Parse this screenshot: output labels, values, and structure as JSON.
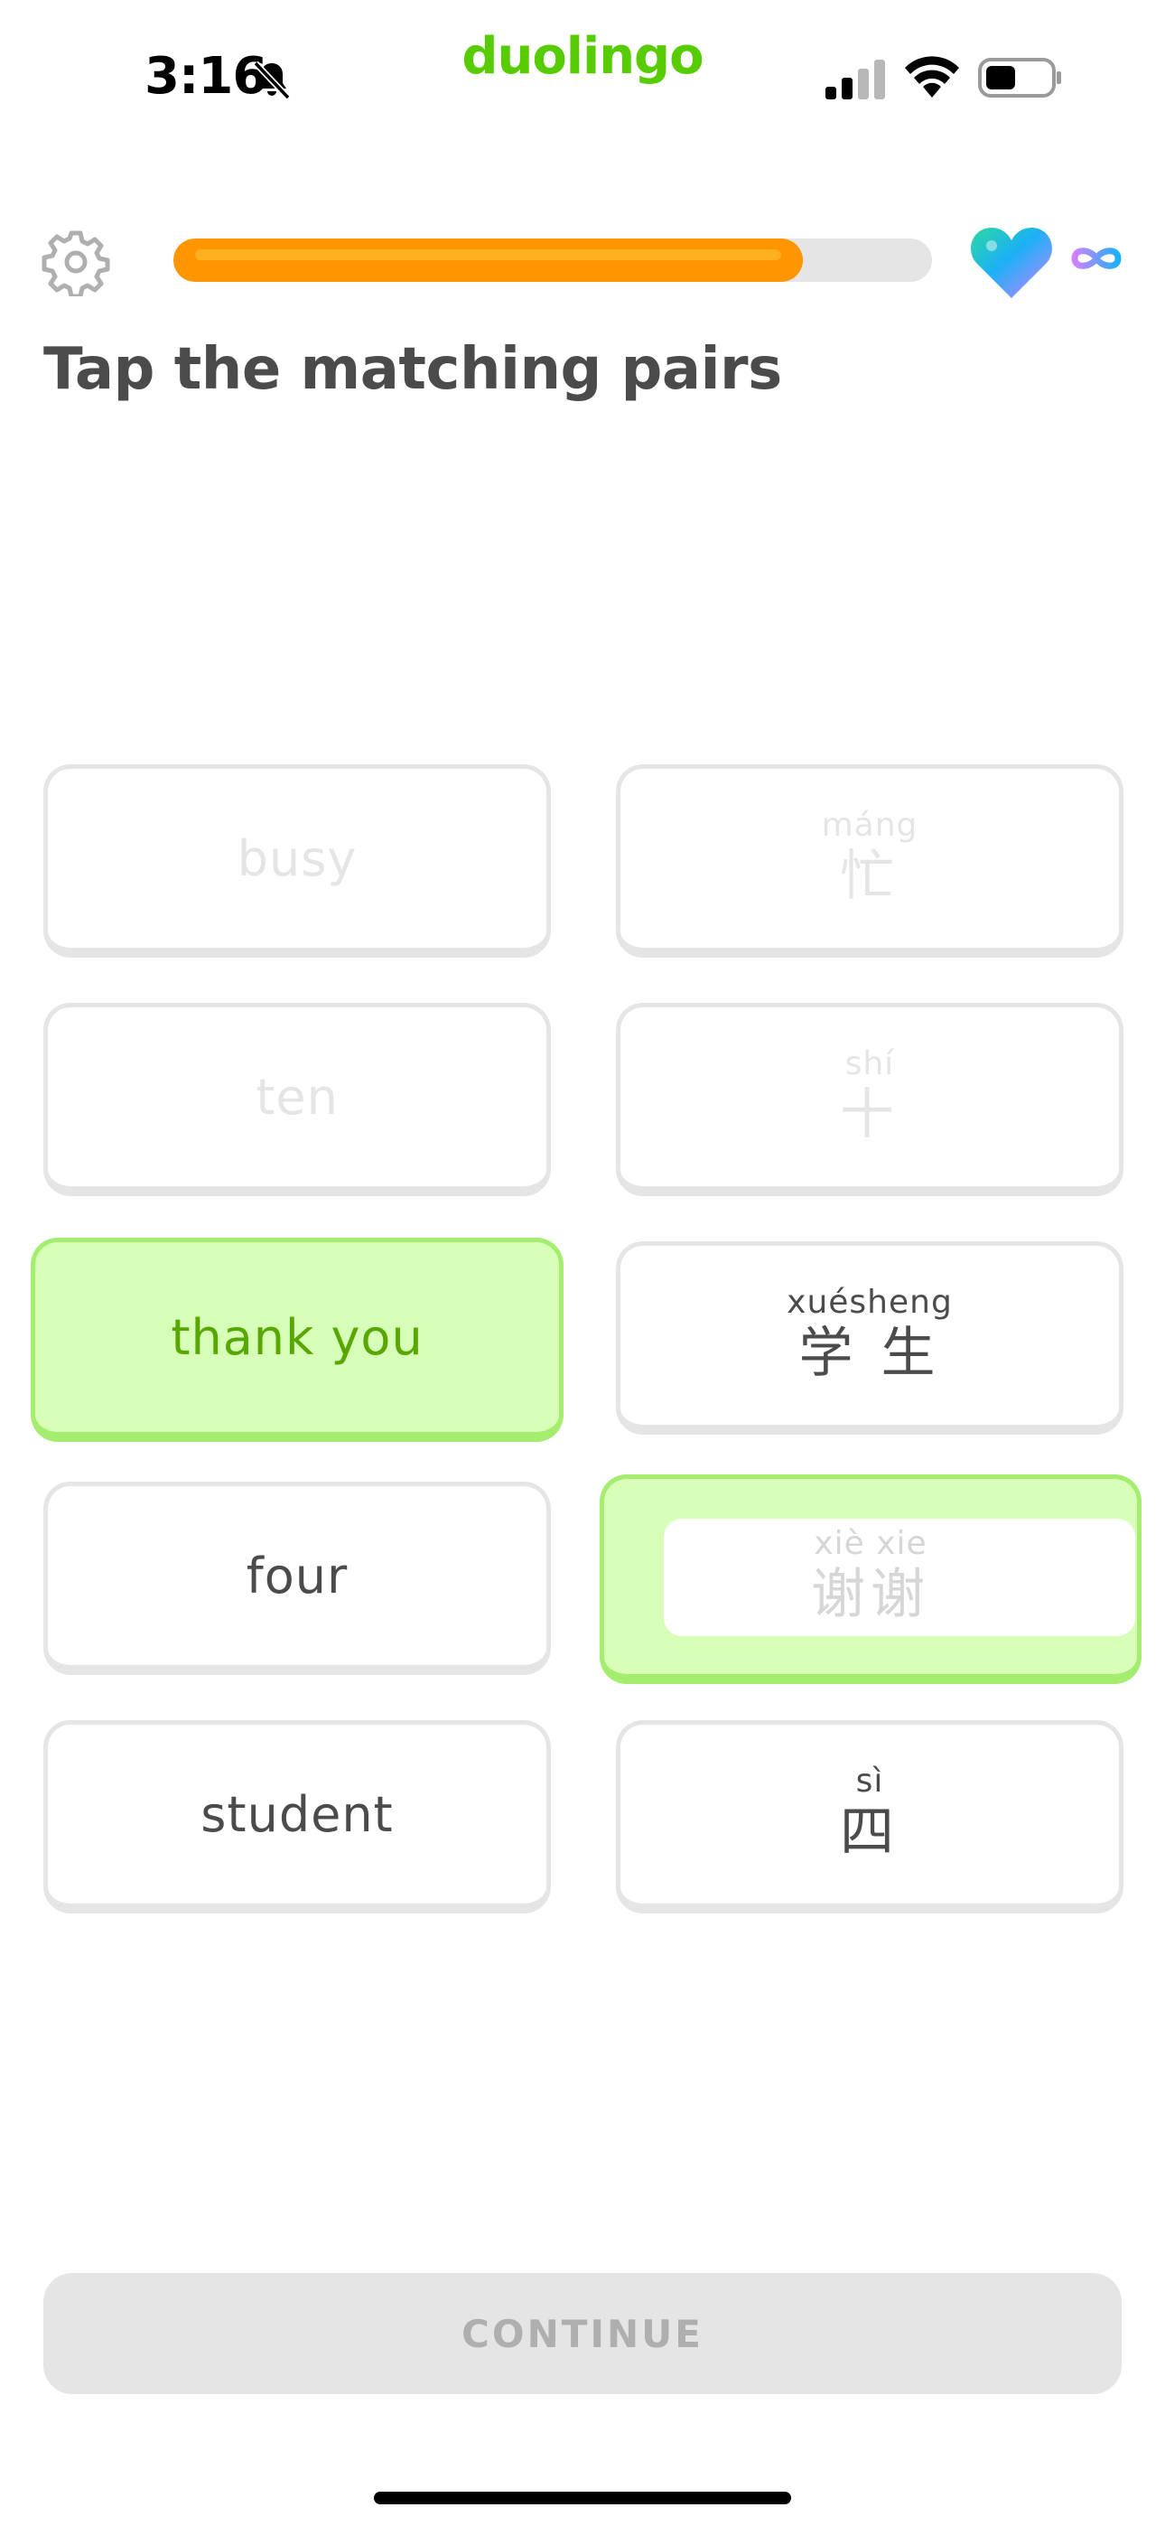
{
  "status_bar": {
    "time": "3:16",
    "app_logo": "duolingo",
    "icons": [
      "bell-slash-icon",
      "cellular-signal-icon",
      "wifi-icon",
      "battery-icon"
    ]
  },
  "header": {
    "settings_icon": "gear-icon",
    "progress_fraction": 0.83,
    "hearts_icon": "heart-icon",
    "hearts_value_icon": "infinity-icon"
  },
  "instruction": "Tap the matching pairs",
  "tiles": {
    "left": [
      {
        "text": "busy",
        "state": "disabled"
      },
      {
        "text": "ten",
        "state": "disabled"
      },
      {
        "text": "thank you",
        "state": "selected"
      },
      {
        "text": "four",
        "state": "default"
      },
      {
        "text": "student",
        "state": "default"
      }
    ],
    "right": [
      {
        "pinyin": "máng",
        "hanzi": "忙",
        "state": "disabled"
      },
      {
        "pinyin": "shí",
        "hanzi": "十",
        "state": "disabled"
      },
      {
        "pinyin": "xuésheng",
        "hanzi": "学 生",
        "state": "default"
      },
      {
        "pinyin": "xiè xie",
        "hanzi": "谢谢",
        "state": "selected"
      },
      {
        "pinyin": "sì",
        "hanzi": "四",
        "state": "default"
      }
    ]
  },
  "continue_label": "CONTINUE",
  "colors": {
    "brand_green": "#58cc02",
    "progress_orange": "#ff9600",
    "selected_bg": "#d7ffb8",
    "selected_border": "#a5ed6e",
    "selected_text": "#58a700",
    "tile_border": "#e5e5e5",
    "text_dark": "#4b4b4b"
  }
}
